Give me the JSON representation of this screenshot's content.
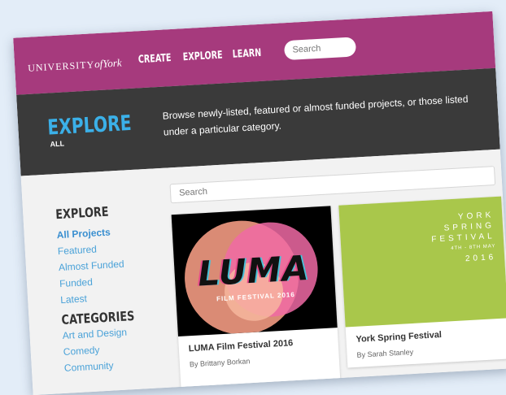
{
  "nav": {
    "logo_main": "UNIVERSITY",
    "logo_of": "of",
    "logo_york": "York",
    "links": [
      "CREATE",
      "EXPLORE",
      "LEARN"
    ],
    "search_placeholder": "Search"
  },
  "hero": {
    "title": "EXPLORE",
    "subtitle": "ALL",
    "description": "Browse newly-listed, featured or almost funded projects, or those listed under a particular category."
  },
  "sidebar": {
    "explore_heading": "EXPLORE",
    "explore_items": [
      "All Projects",
      "Featured",
      "Almost Funded",
      "Funded",
      "Latest"
    ],
    "categories_heading": "CATEGORIES",
    "category_items": [
      "Art and Design",
      "Comedy",
      "Community"
    ]
  },
  "main": {
    "search_placeholder": "Search",
    "cards": [
      {
        "title": "LUMA Film Festival 2016",
        "by": "By Brittany Borkan",
        "image_text": "LUMA",
        "image_subtext": "FILM FESTIVAL 2016"
      },
      {
        "title": "York Spring Festival",
        "by": "By Sarah Stanley",
        "image_lines": [
          "YORK",
          "SPRING",
          "FESTIVAL",
          "4TH - 8TH MAY",
          "2016"
        ]
      }
    ]
  },
  "colors": {
    "brand_magenta": "#a63a7d",
    "hero_bg": "#3a3a3a",
    "accent_blue": "#3bb0e8",
    "york_green": "#a9c74b"
  }
}
